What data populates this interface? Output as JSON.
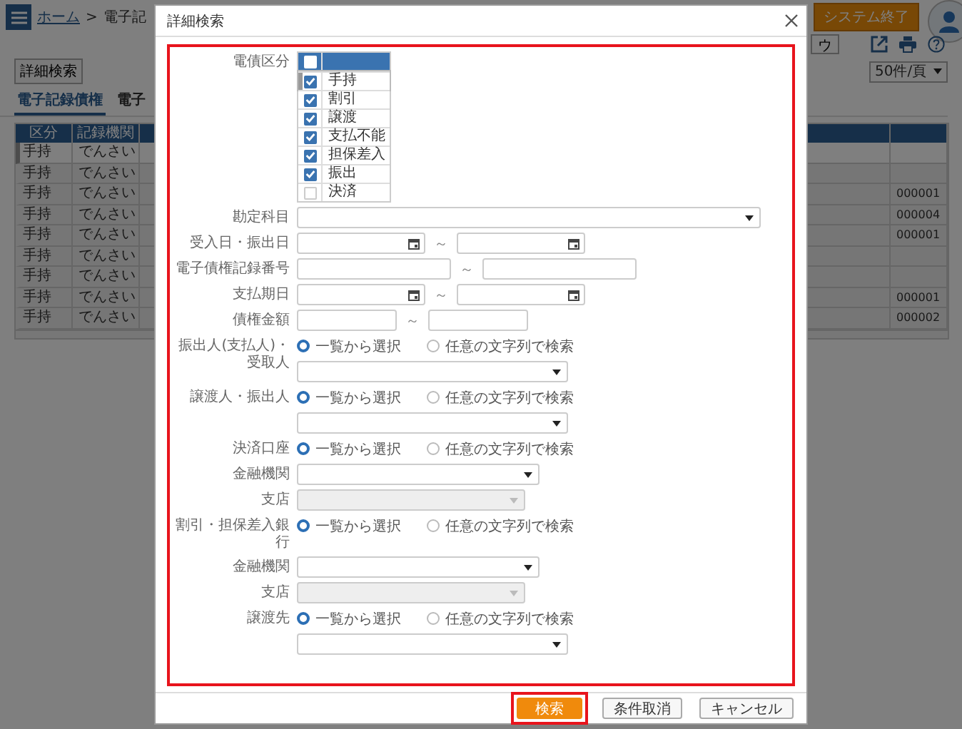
{
  "header": {
    "home_link": "ホーム",
    "separator": ">",
    "page_title": "電子記",
    "exit_button": "システム終了"
  },
  "toolbar": {
    "partial_button": "ウ"
  },
  "detail_search_button": "詳細検索",
  "page_size": "50件/頁",
  "tabs": [
    {
      "label": "電子記録債権",
      "selected": true
    },
    {
      "label": "電子",
      "selected": false
    }
  ],
  "table": {
    "columns": [
      "区分",
      "記録機関"
    ],
    "rows": [
      {
        "type": "手持",
        "agency": "でんさい",
        "selected": true
      },
      {
        "type": "手持",
        "agency": "でんさい",
        "selected": false
      },
      {
        "type": "手持",
        "agency": "でんさい",
        "column_last": "000001",
        "selected": false
      },
      {
        "type": "手持",
        "agency": "でんさい",
        "column_last": "000004",
        "selected": false
      },
      {
        "type": "手持",
        "agency": "でんさい",
        "column_last": "000001",
        "selected": false
      },
      {
        "type": "手持",
        "agency": "でんさい",
        "selected": false
      },
      {
        "type": "手持",
        "agency": "でんさい",
        "selected": false
      },
      {
        "type": "手持",
        "agency": "でんさい",
        "column_last": "000001",
        "selected": false
      },
      {
        "type": "手持",
        "agency": "でんさい",
        "column_last": "000002",
        "selected": false
      }
    ]
  },
  "dialog": {
    "title": "詳細検索",
    "form_highlighted": true,
    "fields": [
      {
        "label": "電債区分",
        "kind": "checklist",
        "all_checked": false,
        "items": [
          {
            "label": "手持",
            "checked": true,
            "focused": true
          },
          {
            "label": "割引",
            "checked": true,
            "focused": false
          },
          {
            "label": "譲渡",
            "checked": true,
            "focused": false
          },
          {
            "label": "支払不能",
            "checked": true,
            "focused": false
          },
          {
            "label": "担保差入",
            "checked": true,
            "focused": false
          },
          {
            "label": "振出",
            "checked": true,
            "focused": false
          },
          {
            "label": "決済",
            "checked": false,
            "focused": false
          }
        ]
      },
      {
        "label": "勘定科目",
        "kind": "wide_select",
        "disabled": false
      },
      {
        "label": "受入日・振出日",
        "kind": "date_range",
        "separator": "～"
      },
      {
        "label": "電子債権記録番号",
        "kind": "wide_range",
        "separator": "～"
      },
      {
        "label": "支払期日",
        "kind": "date_range",
        "separator": "～"
      },
      {
        "label": "債権金額",
        "kind": "short_range",
        "separator": "～"
      },
      {
        "label": "振出人(支払人)・受取人",
        "kind": "radio",
        "with_select": true,
        "options": [
          {
            "label": "一覧から選択",
            "selected": true
          },
          {
            "label": "任意の文字列で検索",
            "selected": false
          }
        ]
      },
      {
        "label": "譲渡人・振出人",
        "kind": "radio",
        "with_select": true,
        "options": [
          {
            "label": "一覧から選択",
            "selected": true
          },
          {
            "label": "任意の文字列で検索",
            "selected": false
          }
        ]
      },
      {
        "label": "決済口座",
        "kind": "radio",
        "with_select": false,
        "options": [
          {
            "label": "一覧から選択",
            "selected": true
          },
          {
            "label": "任意の文字列で検索",
            "selected": false
          }
        ]
      },
      {
        "label": "金融機関",
        "kind": "select",
        "disabled": false
      },
      {
        "label": "支店",
        "kind": "narrow_select",
        "disabled": true
      },
      {
        "label": "割引・担保差入銀行",
        "kind": "radio",
        "with_select": false,
        "options": [
          {
            "label": "一覧から選択",
            "selected": true
          },
          {
            "label": "任意の文字列で検索",
            "selected": false
          }
        ]
      },
      {
        "label": "金融機関",
        "kind": "select",
        "disabled": false
      },
      {
        "label": "支店",
        "kind": "narrow_select",
        "disabled": true
      },
      {
        "label": "譲渡先",
        "kind": "radio",
        "with_select": true,
        "options": [
          {
            "label": "一覧から選択",
            "selected": true
          },
          {
            "label": "任意の文字列で検索",
            "selected": false
          }
        ]
      }
    ],
    "buttons": [
      {
        "label": "検索",
        "kind": "primary",
        "highlighted": true
      },
      {
        "label": "条件取消",
        "kind": "default",
        "highlighted": false
      },
      {
        "label": "キャンセル",
        "kind": "default",
        "highlighted": false
      }
    ]
  }
}
